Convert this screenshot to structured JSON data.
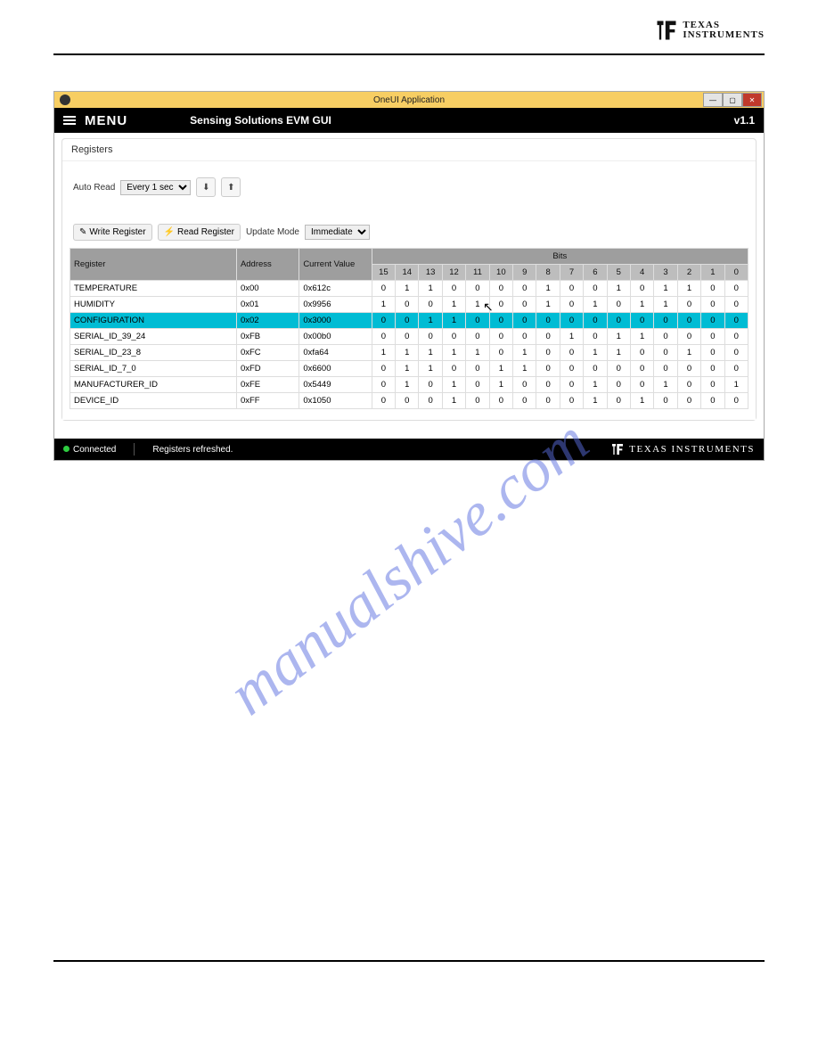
{
  "header": {
    "brand_top": "TEXAS",
    "brand_bottom": "INSTRUMENTS"
  },
  "window": {
    "title": "OneUI Application",
    "menu_label": "MENU",
    "subtitle": "Sensing Solutions EVM GUI",
    "version": "v1.1"
  },
  "panel": {
    "title": "Registers",
    "auto_read_label": "Auto Read",
    "auto_read_value": "Every 1 sec",
    "write_btn": "Write Register",
    "read_btn": "Read Register",
    "update_mode_label": "Update Mode",
    "update_mode_value": "Immediate",
    "col_register": "Register",
    "col_address": "Address",
    "col_value": "Current Value",
    "col_bits": "Bits"
  },
  "bits_header": [
    "15",
    "14",
    "13",
    "12",
    "11",
    "10",
    "9",
    "8",
    "7",
    "6",
    "5",
    "4",
    "3",
    "2",
    "1",
    "0"
  ],
  "registers": [
    {
      "name": "TEMPERATURE",
      "addr": "0x00",
      "val": "0x612c",
      "bits": [
        "0",
        "1",
        "1",
        "0",
        "0",
        "0",
        "0",
        "1",
        "0",
        "0",
        "1",
        "0",
        "1",
        "1",
        "0",
        "0"
      ],
      "selected": false
    },
    {
      "name": "HUMIDITY",
      "addr": "0x01",
      "val": "0x9956",
      "bits": [
        "1",
        "0",
        "0",
        "1",
        "1",
        "0",
        "0",
        "1",
        "0",
        "1",
        "0",
        "1",
        "1",
        "0",
        "0",
        "0"
      ],
      "selected": false
    },
    {
      "name": "CONFIGURATION",
      "addr": "0x02",
      "val": "0x3000",
      "bits": [
        "0",
        "0",
        "1",
        "1",
        "0",
        "0",
        "0",
        "0",
        "0",
        "0",
        "0",
        "0",
        "0",
        "0",
        "0",
        "0"
      ],
      "selected": true
    },
    {
      "name": "SERIAL_ID_39_24",
      "addr": "0xFB",
      "val": "0x00b0",
      "bits": [
        "0",
        "0",
        "0",
        "0",
        "0",
        "0",
        "0",
        "0",
        "1",
        "0",
        "1",
        "1",
        "0",
        "0",
        "0",
        "0"
      ],
      "selected": false
    },
    {
      "name": "SERIAL_ID_23_8",
      "addr": "0xFC",
      "val": "0xfa64",
      "bits": [
        "1",
        "1",
        "1",
        "1",
        "1",
        "0",
        "1",
        "0",
        "0",
        "1",
        "1",
        "0",
        "0",
        "1",
        "0",
        "0"
      ],
      "selected": false
    },
    {
      "name": "SERIAL_ID_7_0",
      "addr": "0xFD",
      "val": "0x6600",
      "bits": [
        "0",
        "1",
        "1",
        "0",
        "0",
        "1",
        "1",
        "0",
        "0",
        "0",
        "0",
        "0",
        "0",
        "0",
        "0",
        "0"
      ],
      "selected": false
    },
    {
      "name": "MANUFACTURER_ID",
      "addr": "0xFE",
      "val": "0x5449",
      "bits": [
        "0",
        "1",
        "0",
        "1",
        "0",
        "1",
        "0",
        "0",
        "0",
        "1",
        "0",
        "0",
        "1",
        "0",
        "0",
        "1"
      ],
      "selected": false
    },
    {
      "name": "DEVICE_ID",
      "addr": "0xFF",
      "val": "0x1050",
      "bits": [
        "0",
        "0",
        "0",
        "1",
        "0",
        "0",
        "0",
        "0",
        "0",
        "1",
        "0",
        "1",
        "0",
        "0",
        "0",
        "0"
      ],
      "selected": false
    }
  ],
  "status": {
    "connected": "Connected",
    "msg": "Registers refreshed.",
    "brand": "TEXAS INSTRUMENTS"
  },
  "watermark": "manualshive.com"
}
